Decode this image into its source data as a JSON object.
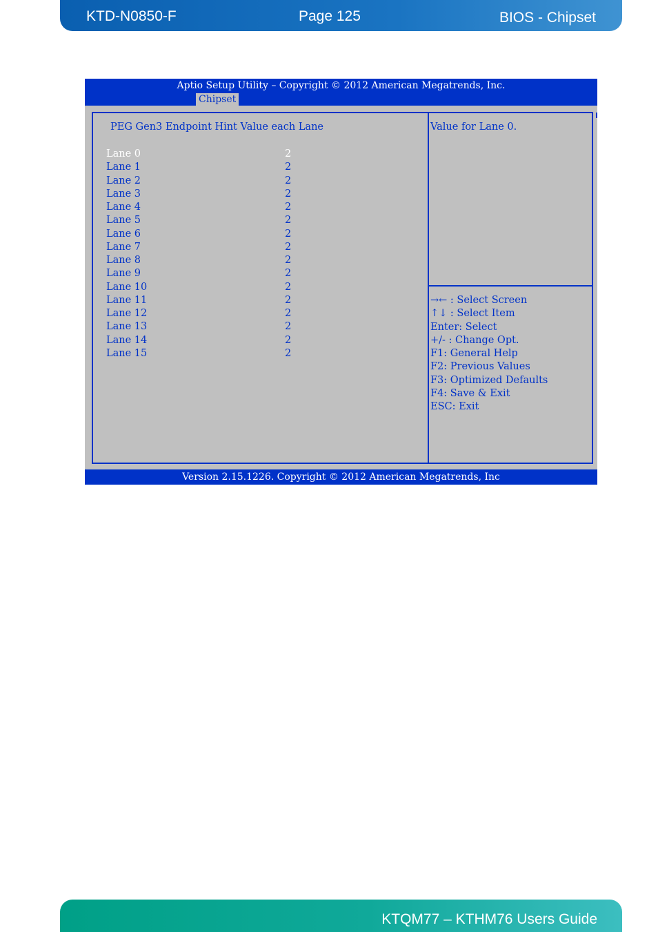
{
  "document": {
    "header": {
      "doc_id": "KTD-N0850-F",
      "page": "Page 125",
      "section": "BIOS - Chipset",
      "color": "#0a5fb0"
    },
    "footer": {
      "title": "KTQM77 – KTHM76 Users Guide",
      "color": "#00a087"
    }
  },
  "bios": {
    "title": "Aptio Setup Utility  –  Copyright © 2012 American Megatrends, Inc.",
    "active_tab": "Chipset",
    "section_title": "PEG Gen3 Endpoint Hint Value each Lane",
    "lanes": [
      {
        "label": "Lane 0",
        "value": "2"
      },
      {
        "label": "Lane 1",
        "value": "2"
      },
      {
        "label": "Lane 2",
        "value": "2"
      },
      {
        "label": "Lane 3",
        "value": "2"
      },
      {
        "label": "Lane 4",
        "value": "2"
      },
      {
        "label": "Lane 5",
        "value": "2"
      },
      {
        "label": "Lane 6",
        "value": "2"
      },
      {
        "label": "Lane 7",
        "value": "2"
      },
      {
        "label": "Lane 8",
        "value": "2"
      },
      {
        "label": "Lane 9",
        "value": "2"
      },
      {
        "label": "Lane 10",
        "value": "2"
      },
      {
        "label": "Lane 11",
        "value": "2"
      },
      {
        "label": "Lane 12",
        "value": "2"
      },
      {
        "label": "Lane 13",
        "value": "2"
      },
      {
        "label": "Lane 14",
        "value": "2"
      },
      {
        "label": "Lane 15",
        "value": "2"
      }
    ],
    "selected_lane": "Lane 0",
    "help_text": "Value for Lane 0.",
    "key_help": [
      "→← : Select Screen",
      "↑↓ : Select Item",
      "Enter: Select",
      "+/- : Change Opt.",
      "F1: General Help",
      "F2: Previous Values",
      "F3: Optimized Defaults",
      "F4: Save & Exit",
      "ESC: Exit"
    ],
    "footer": "Version 2.15.1226. Copyright © 2012 American Megatrends, Inc",
    "colors": {
      "background": "#c0c0c0",
      "accent": "#0032c8",
      "highlight_text": "#ffffff"
    }
  }
}
